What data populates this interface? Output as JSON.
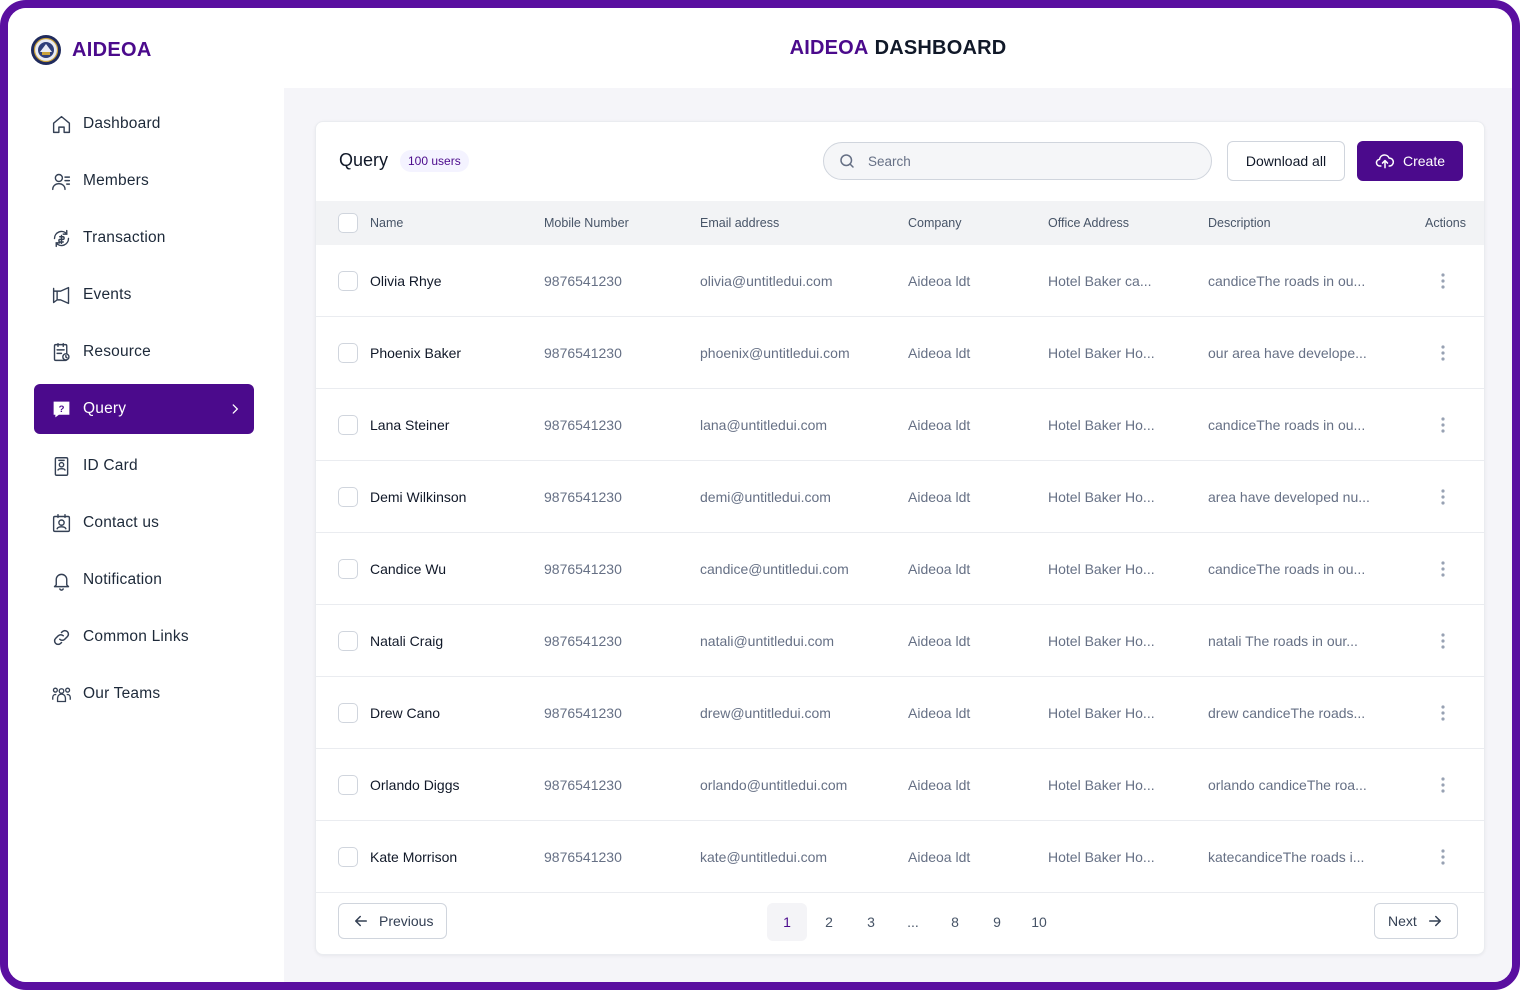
{
  "app": {
    "brand": "AIDEOA",
    "title_accent": "AIDEOA",
    "title_rest": "DASHBOARD",
    "colors": {
      "accent": "#4b0a8c",
      "frame": "#5a0fa0"
    }
  },
  "sidebar": {
    "items": [
      {
        "label": "Dashboard",
        "icon": "home-icon"
      },
      {
        "label": "Members",
        "icon": "members-icon"
      },
      {
        "label": "Transaction",
        "icon": "transaction-icon"
      },
      {
        "label": "Events",
        "icon": "megaphone-icon"
      },
      {
        "label": "Resource",
        "icon": "resource-icon"
      },
      {
        "label": "Query",
        "icon": "query-icon",
        "active": true
      },
      {
        "label": "ID Card",
        "icon": "id-card-icon"
      },
      {
        "label": "Contact us",
        "icon": "contact-icon"
      },
      {
        "label": "Notification",
        "icon": "bell-icon"
      },
      {
        "label": "Common Links",
        "icon": "link-icon"
      },
      {
        "label": "Our Teams",
        "icon": "teams-icon"
      }
    ]
  },
  "query": {
    "title": "Query",
    "count_badge": "100 users",
    "search_placeholder": "Search",
    "download_label": "Download all",
    "create_label": "Create",
    "columns": {
      "name": "Name",
      "mobile": "Mobile Number",
      "email": "Email address",
      "company": "Company",
      "office": "Office Address",
      "description": "Description",
      "actions": "Actions"
    },
    "rows": [
      {
        "name": "Olivia Rhye",
        "mobile": "9876541230",
        "email": "olivia@untitledui.com",
        "company": "Aideoa ldt",
        "office": "Hotel Baker ca...",
        "description": "candiceThe roads in ou..."
      },
      {
        "name": "Phoenix Baker",
        "mobile": "9876541230",
        "email": "phoenix@untitledui.com",
        "company": "Aideoa ldt",
        "office": "Hotel Baker Ho...",
        "description": "our area have develope..."
      },
      {
        "name": "Lana Steiner",
        "mobile": "9876541230",
        "email": "lana@untitledui.com",
        "company": "Aideoa ldt",
        "office": "Hotel Baker Ho...",
        "description": "candiceThe roads in ou..."
      },
      {
        "name": "Demi Wilkinson",
        "mobile": "9876541230",
        "email": "demi@untitledui.com",
        "company": "Aideoa ldt",
        "office": "Hotel Baker Ho...",
        "description": "area have developed nu..."
      },
      {
        "name": "Candice Wu",
        "mobile": "9876541230",
        "email": "candice@untitledui.com",
        "company": "Aideoa ldt",
        "office": "Hotel Baker Ho...",
        "description": "candiceThe roads in ou..."
      },
      {
        "name": "Natali Craig",
        "mobile": "9876541230",
        "email": "natali@untitledui.com",
        "company": "Aideoa ldt",
        "office": "Hotel Baker Ho...",
        "description": "natali The roads in our..."
      },
      {
        "name": "Drew Cano",
        "mobile": "9876541230",
        "email": "drew@untitledui.com",
        "company": "Aideoa ldt",
        "office": "Hotel Baker Ho...",
        "description": "drew candiceThe roads..."
      },
      {
        "name": "Orlando Diggs",
        "mobile": "9876541230",
        "email": "orlando@untitledui.com",
        "company": "Aideoa ldt",
        "office": "Hotel Baker Ho...",
        "description": "orlando candiceThe roa..."
      },
      {
        "name": "Kate Morrison",
        "mobile": "9876541230",
        "email": "kate@untitledui.com",
        "company": "Aideoa ldt",
        "office": "Hotel Baker Ho...",
        "description": "katecandiceThe roads i..."
      }
    ]
  },
  "pagination": {
    "previous_label": "Previous",
    "next_label": "Next",
    "pages": [
      "1",
      "2",
      "3",
      "...",
      "8",
      "9",
      "10"
    ],
    "current": "1"
  }
}
